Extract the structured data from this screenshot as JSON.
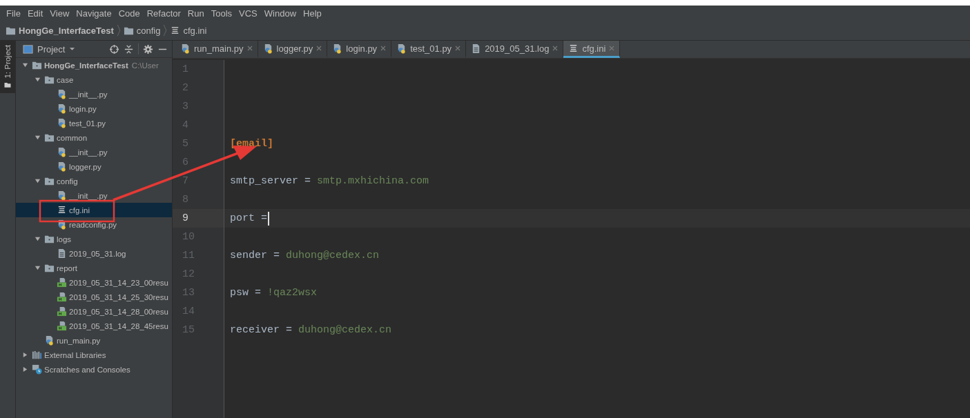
{
  "menu": [
    "File",
    "Edit",
    "View",
    "Navigate",
    "Code",
    "Refactor",
    "Run",
    "Tools",
    "VCS",
    "Window",
    "Help"
  ],
  "breadcrumb": [
    {
      "label": "HongGe_InterfaceTest",
      "kind": "project"
    },
    {
      "label": "config",
      "kind": "folder"
    },
    {
      "label": "cfg.ini",
      "kind": "ini"
    }
  ],
  "side_tab": {
    "label": "1: Project",
    "selected": true
  },
  "project_panel": {
    "title": "Project",
    "tree": [
      {
        "name": "HongGe_InterfaceTest",
        "path": "C:\\User",
        "kind": "folder",
        "expanded": true,
        "selected": false,
        "children": [
          {
            "name": "case",
            "kind": "folder",
            "expanded": true,
            "selected": false,
            "children": [
              {
                "name": "__init__.py",
                "kind": "python",
                "selected": false
              },
              {
                "name": "login.py",
                "kind": "python",
                "selected": false
              },
              {
                "name": "test_01.py",
                "kind": "python",
                "selected": false
              }
            ]
          },
          {
            "name": "common",
            "kind": "folder",
            "expanded": true,
            "selected": false,
            "children": [
              {
                "name": "__init__.py",
                "kind": "python",
                "selected": false
              },
              {
                "name": "logger.py",
                "kind": "python",
                "selected": false
              }
            ]
          },
          {
            "name": "config",
            "kind": "folder",
            "expanded": true,
            "selected": false,
            "children": [
              {
                "name": "__init__.py",
                "kind": "python",
                "selected": false
              },
              {
                "name": "cfg.ini",
                "kind": "ini",
                "selected": true
              },
              {
                "name": "readconfig.py",
                "kind": "python",
                "selected": false
              }
            ]
          },
          {
            "name": "logs",
            "kind": "folder",
            "expanded": true,
            "selected": false,
            "children": [
              {
                "name": "2019_05_31.log",
                "kind": "log",
                "selected": false
              }
            ]
          },
          {
            "name": "report",
            "kind": "folder",
            "expanded": true,
            "selected": false,
            "children": [
              {
                "name": "2019_05_31_14_23_00resu",
                "kind": "html",
                "selected": false
              },
              {
                "name": "2019_05_31_14_25_30resu",
                "kind": "html",
                "selected": false
              },
              {
                "name": "2019_05_31_14_28_00resu",
                "kind": "html",
                "selected": false
              },
              {
                "name": "2019_05_31_14_28_45resu",
                "kind": "html",
                "selected": false
              }
            ]
          },
          {
            "name": "run_main.py",
            "kind": "python",
            "selected": false
          }
        ]
      },
      {
        "name": "External Libraries",
        "kind": "library",
        "expanded": false,
        "selected": false
      },
      {
        "name": "Scratches and Consoles",
        "kind": "scratches",
        "expanded": false,
        "selected": false
      }
    ]
  },
  "tabs": [
    {
      "label": "run_main.py",
      "kind": "python",
      "selected": false
    },
    {
      "label": "logger.py",
      "kind": "python",
      "selected": false
    },
    {
      "label": "login.py",
      "kind": "python",
      "selected": false
    },
    {
      "label": "test_01.py",
      "kind": "python",
      "selected": false
    },
    {
      "label": "2019_05_31.log",
      "kind": "log",
      "selected": false
    },
    {
      "label": "cfg.ini",
      "kind": "ini",
      "selected": true
    }
  ],
  "editor": {
    "lines": [
      {
        "number": "1",
        "kind": "blank",
        "current": false
      },
      {
        "number": "2",
        "kind": "blank",
        "current": false
      },
      {
        "number": "3",
        "kind": "blank",
        "current": false
      },
      {
        "number": "4",
        "kind": "blank",
        "current": false
      },
      {
        "number": "5",
        "kind": "section",
        "text": "[email]",
        "current": false
      },
      {
        "number": "6",
        "kind": "blank",
        "current": false
      },
      {
        "number": "7",
        "kind": "pair",
        "key": "smtp_server",
        "sep": "=",
        "value": "smtp.mxhichina.com",
        "current": false
      },
      {
        "number": "8",
        "kind": "blank",
        "current": false
      },
      {
        "number": "9",
        "kind": "pair",
        "key": "port",
        "sep": "=",
        "current": true
      },
      {
        "number": "10",
        "kind": "blank",
        "current": false
      },
      {
        "number": "11",
        "kind": "pair",
        "key": "sender",
        "sep": "=",
        "value": "duhong@cedex.cn",
        "current": false
      },
      {
        "number": "12",
        "kind": "blank",
        "current": false
      },
      {
        "number": "13",
        "kind": "pair",
        "key": "psw",
        "sep": "=",
        "value": "!qaz2wsx",
        "current": false
      },
      {
        "number": "14",
        "kind": "blank",
        "current": false
      },
      {
        "number": "15",
        "kind": "pair",
        "key": "receiver",
        "sep": "=",
        "value": "duhong@cedex.cn",
        "current": false
      }
    ]
  }
}
